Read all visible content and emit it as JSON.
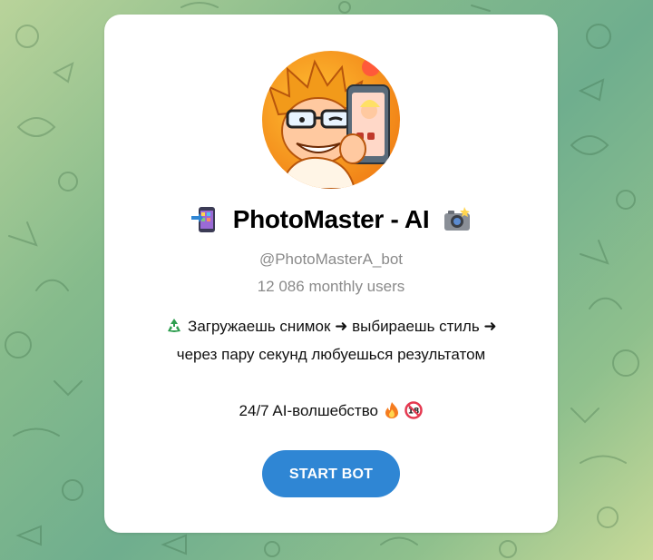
{
  "bot": {
    "title": "PhotoMaster - AI",
    "title_icon_left": "mobile-phone-arrow-icon",
    "title_icon_right": "camera-flash-icon",
    "username": "@PhotoMasterA_bot",
    "monthly_users": "12 086 monthly users",
    "description": {
      "line1_text": "Загружаешь снимок ➜ выбираешь стиль ➜",
      "line1_icon": "recycle-icon",
      "line2_text": "через пару секунд любуешься результатом",
      "line3_text": "24/7 AI-волшебство",
      "line3_icons": [
        "fire-icon",
        "no-under-18-icon"
      ]
    },
    "start_button_label": "START BOT",
    "avatar_icon": "cartoon-photographer-avatar"
  },
  "colors": {
    "accent": "#2f86d4",
    "muted_text": "#8a8a8a",
    "card_bg": "#ffffff",
    "bg_green": "#6fae8e"
  }
}
